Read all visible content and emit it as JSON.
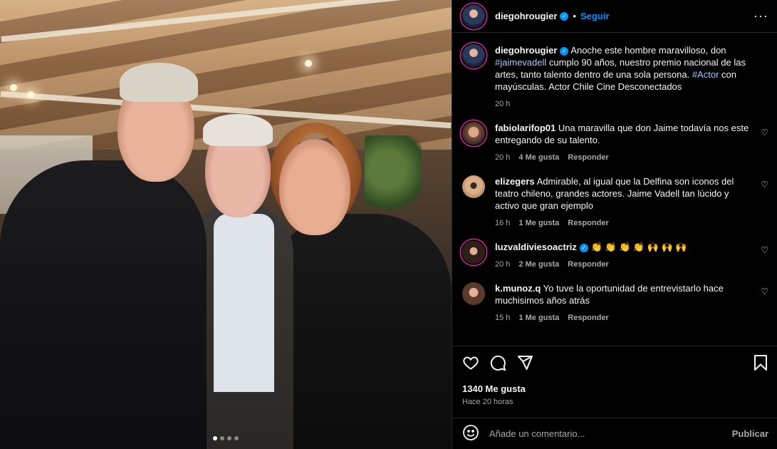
{
  "post": {
    "username": "diegohrougier",
    "separator": "•",
    "follow_label": "Seguir",
    "more_icon": "more-icon",
    "photo_index": 1,
    "photo_count": 4
  },
  "caption": {
    "username": "diegohrougier",
    "text_1": "Anoche este hombre maravilloso, don",
    "hashtag_1": "#jaimevadell",
    "text_2": "cumplo 90 años, nuestro premio nacional de las artes, tanto talento dentro de una sola persona.",
    "hashtag_2": "#Actor",
    "text_3": "con mayúsculas. Actor Chile Cine Desconectados",
    "time": "20 h"
  },
  "comments": [
    {
      "username": "fabiolarifop01",
      "text": "Una maravilla que don Jaime todavía nos este entregando de su talento.",
      "time": "20 h",
      "likes": "4 Me gusta",
      "reply": "Responder",
      "verified": false,
      "avatar_color": "#8a5a4a"
    },
    {
      "username": "elizegers",
      "text": "Admirable, al igual que la Delfina son iconos del teatro chileno, grandes actores. Jaime Vadell tan lúcido y activo que gran ejemplo",
      "time": "16 h",
      "likes": "1 Me gusta",
      "reply": "Responder",
      "verified": false,
      "avatar_color": "#c8946a"
    },
    {
      "username": "luzvaldiviesoactriz",
      "text": "👏 👏 👏 👏 🙌 🙌 🙌",
      "time": "20 h",
      "likes": "2 Me gusta",
      "reply": "Responder",
      "verified": true,
      "avatar_color": "#3a2a22"
    },
    {
      "username": "k.munoz.q",
      "text": "Yo tuve la oportunidad de entrevistarlo hace muchisimos años atrás",
      "time": "15 h",
      "likes": "1 Me gusta",
      "reply": "Responder",
      "verified": false,
      "avatar_color": "#6b4a38"
    }
  ],
  "footer": {
    "likes": "1340 Me gusta",
    "ago": "Hace 20 horas",
    "comment_placeholder": "Añade un comentario...",
    "publish_label": "Publicar"
  },
  "colors": {
    "accent": "#0095f6",
    "background": "#000000",
    "muted": "#a8a8a8"
  }
}
